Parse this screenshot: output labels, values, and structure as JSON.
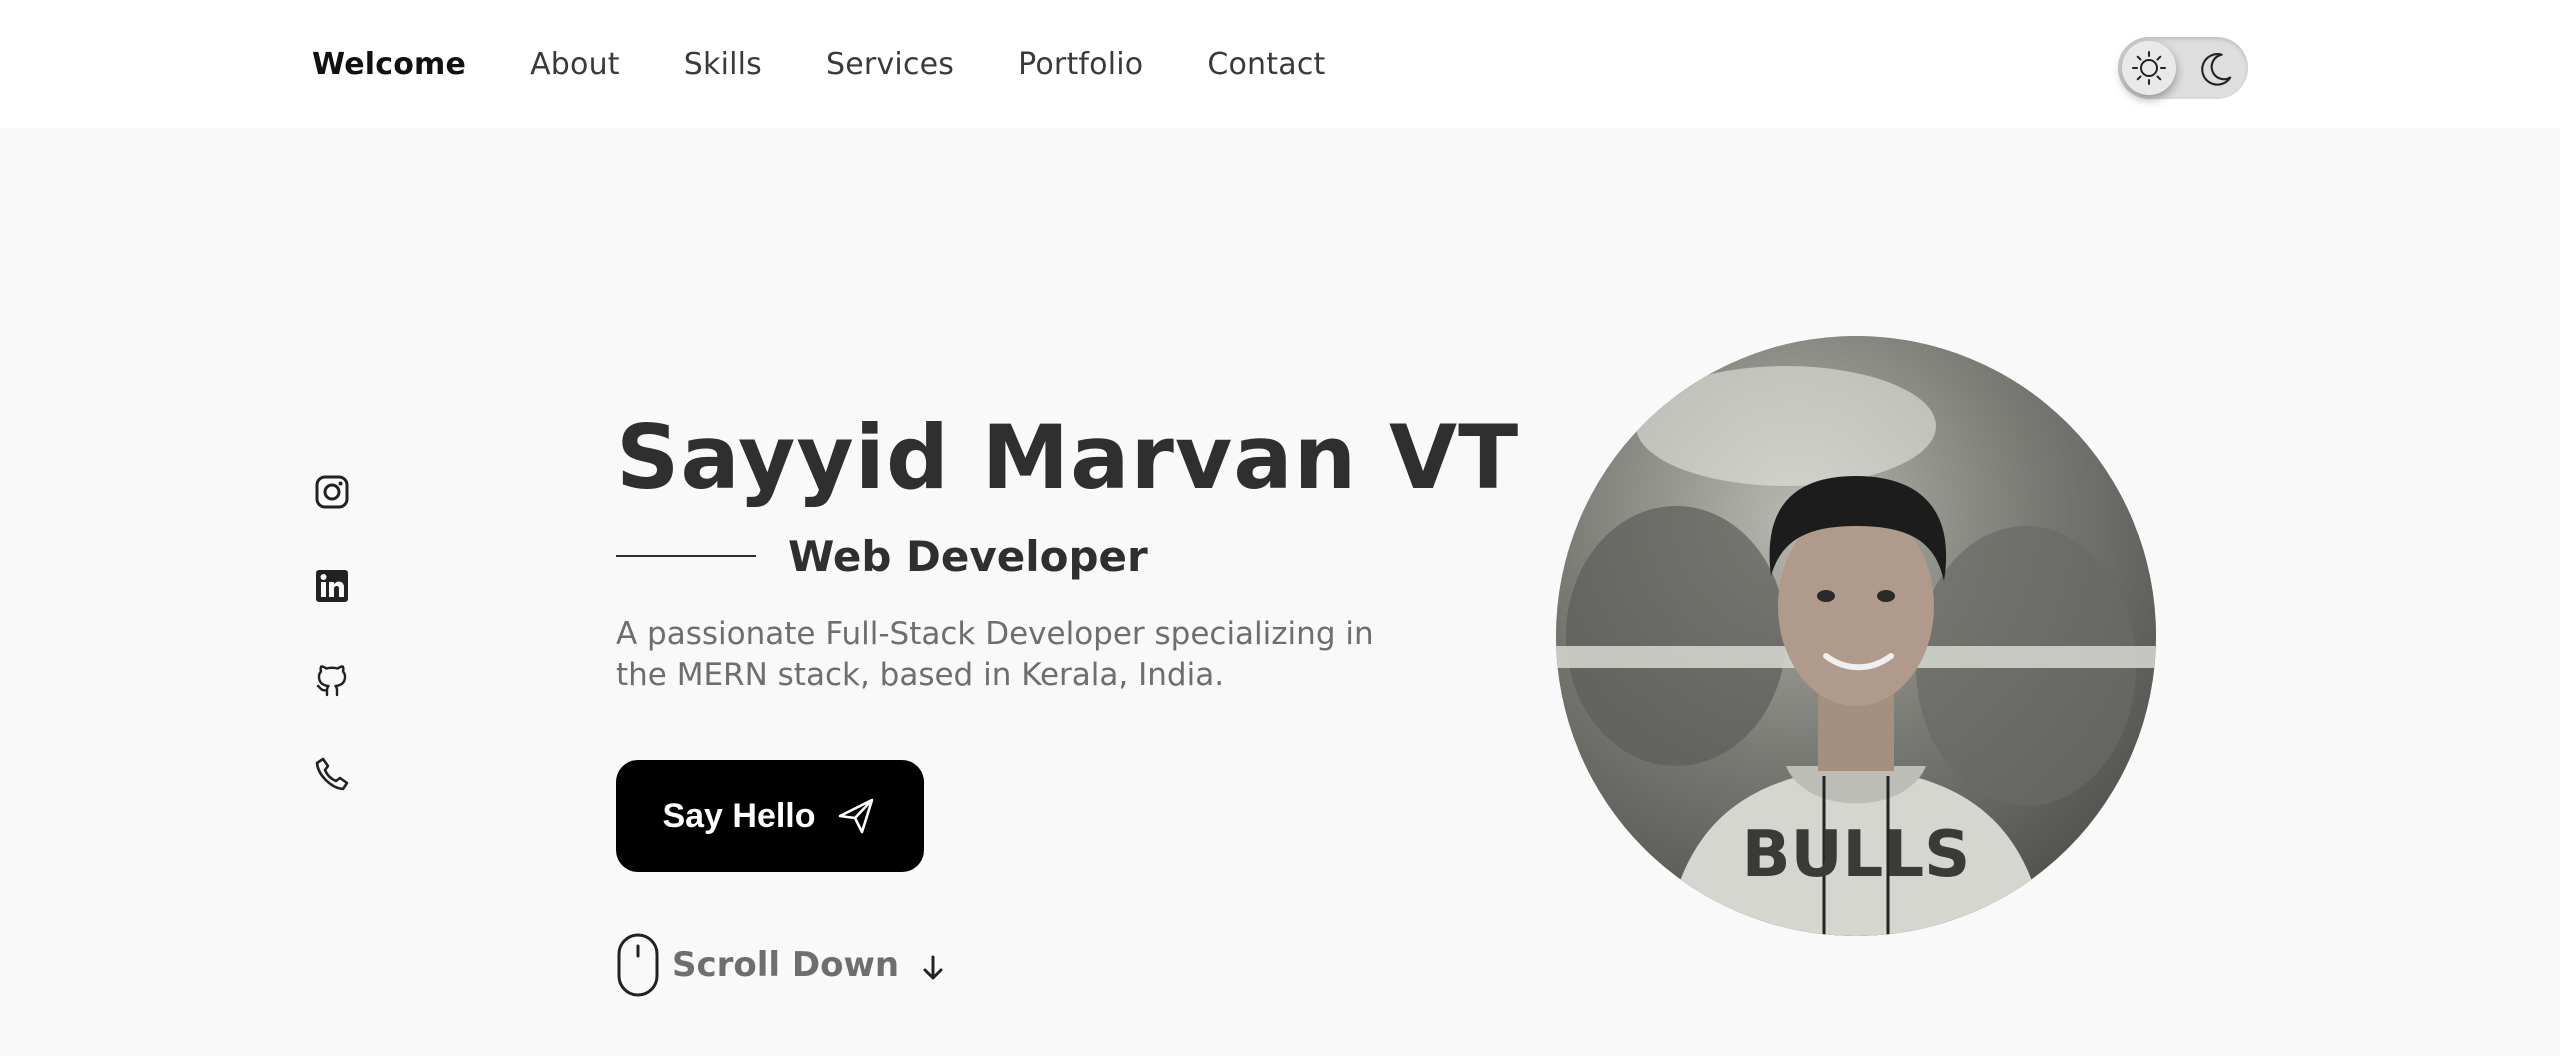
{
  "nav": {
    "items": [
      {
        "label": "Welcome",
        "active": true
      },
      {
        "label": "About"
      },
      {
        "label": "Skills"
      },
      {
        "label": "Services"
      },
      {
        "label": "Portfolio"
      },
      {
        "label": "Contact"
      }
    ]
  },
  "theme_toggle": {
    "mode": "light",
    "icons": [
      "sun-icon",
      "moon-icon"
    ]
  },
  "socials": [
    "instagram-icon",
    "linkedin-icon",
    "github-icon",
    "phone-icon"
  ],
  "hero": {
    "name": "Sayyid Marvan VT",
    "role": "Web Developer",
    "description": "A passionate Full-Stack Developer specializing in the MERN stack, based in Kerala, India.",
    "cta_label": "Say Hello",
    "scroll_label": "Scroll Down"
  },
  "colors": {
    "background": "#f9f9f9",
    "nav_background": "#ffffff",
    "text": "#2f2f2f",
    "muted_text": "#6e6e6e",
    "button": "#000000"
  }
}
